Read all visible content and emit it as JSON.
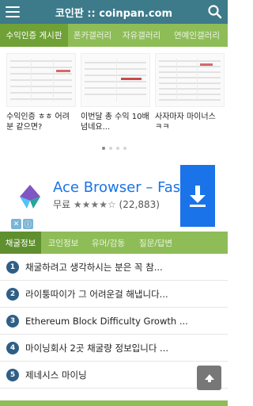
{
  "header": {
    "title": "코인판 :: coinpan.com"
  },
  "category_tabs": [
    {
      "label": "수익인증 게시판",
      "active": true
    },
    {
      "label": "폰카갤러리",
      "active": false
    },
    {
      "label": "자유갤러리",
      "active": false
    },
    {
      "label": "연예인갤러리",
      "active": false
    }
  ],
  "carousel": {
    "slides": [
      {
        "caption": "수익인증 ㅎㅎ 어려분 같으면?"
      },
      {
        "caption": "이번달 총 수익 10배 넘네요..."
      },
      {
        "caption": "사자마자 마이너스 ㅋㅋ"
      }
    ],
    "dots": 4,
    "active_dot": 0
  },
  "ad": {
    "title": "Ace Browser – Fast",
    "free_label": "무료",
    "stars": "★★★★☆",
    "reviews": "(22,883)"
  },
  "board_tabs": [
    {
      "label": "채굴정보",
      "active": true
    },
    {
      "label": "코인정보",
      "active": false
    },
    {
      "label": "유머/감동",
      "active": false
    },
    {
      "label": "질문/답변",
      "active": false
    }
  ],
  "list": [
    {
      "num": "1",
      "text": "채굴하려고 생각하시는 분은 꼭 참..."
    },
    {
      "num": "2",
      "text": "라이퉁따이가 그 어려운걸 해냅니다..."
    },
    {
      "num": "3",
      "text": "Ethereum Block Difficulty Growth ..."
    },
    {
      "num": "4",
      "text": "마이닝회사 2곳 채굴량 정보입니다 ..."
    },
    {
      "num": "5",
      "text": "제네시스 마이닝"
    }
  ],
  "colors": {
    "header": "#3d7a8a",
    "tabs": "#8ebd58",
    "tab_active": "#6fa136",
    "ad_blue": "#1a73e8",
    "number_badge": "#2f5f87"
  },
  "icons": {
    "menu": "hamburger-menu-icon",
    "search": "search-icon",
    "download": "download-icon",
    "scroll_top": "arrow-up-icon",
    "app_logo": "ace-browser-logo-icon"
  }
}
